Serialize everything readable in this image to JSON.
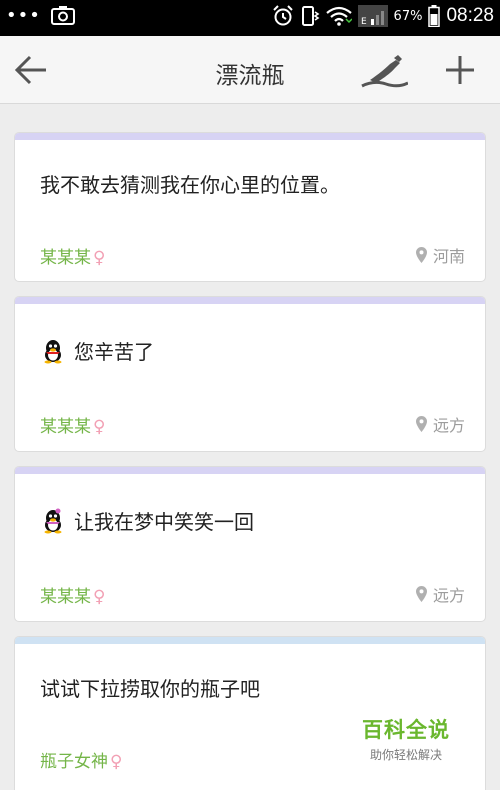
{
  "status_bar": {
    "dots": "•••",
    "battery_percent": "67%",
    "network_label": "E",
    "time": "08:28"
  },
  "header": {
    "title": "漂流瓶",
    "back_icon": "arrow-left-icon",
    "pick_icon": "pick-bottle-icon",
    "add_icon": "plus-icon"
  },
  "bottles": [
    {
      "text": "我不敢去猜测我在你心里的位置。",
      "user": "某某某",
      "gender": "♀",
      "location": "河南",
      "has_avatar": false
    },
    {
      "text": "您辛苦了",
      "user": "某某某",
      "gender": "♀",
      "location": "远方",
      "has_avatar": true
    },
    {
      "text": "让我在梦中笑笑一回",
      "user": "某某某",
      "gender": "♀",
      "location": "远方",
      "has_avatar": true
    },
    {
      "text": "试试下拉捞取你的瓶子吧",
      "user": "瓶子女神",
      "gender": "♀",
      "location": "",
      "has_avatar": false
    }
  ],
  "watermark": {
    "title": "百科全说",
    "subtitle": "助你轻松解决"
  },
  "colors": {
    "accent_green": "#74b548",
    "gender_pink": "#f2a0b4",
    "card_top_purple": "#d7d3f4",
    "card_top_blue": "#cfe2f3"
  }
}
